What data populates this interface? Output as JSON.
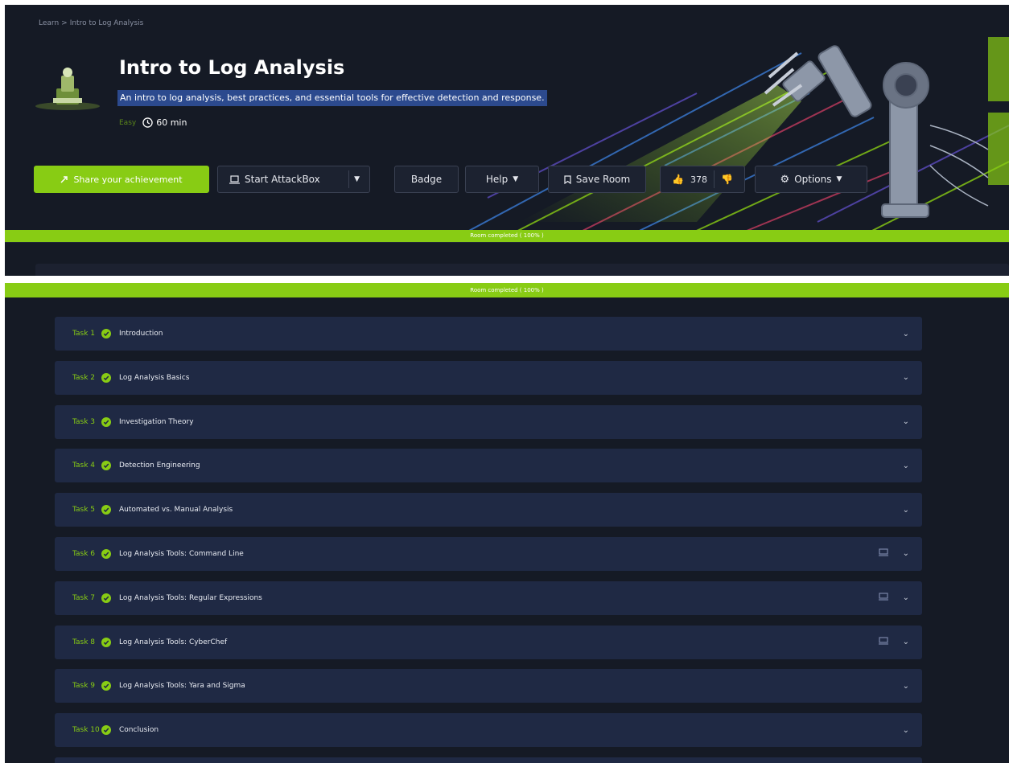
{
  "breadcrumb": {
    "root": "Learn",
    "separator": ">",
    "current": "Intro to Log Analysis"
  },
  "room": {
    "title": "Intro to Log Analysis",
    "description": "An intro to log analysis, best practices, and essential tools for effective detection and response.",
    "difficulty": "Easy",
    "duration": "60 min"
  },
  "toolbar": {
    "share_label": "Share your achievement",
    "attackbox_label": "Start AttackBox",
    "badge_label": "Badge",
    "help_label": "Help",
    "save_label": "Save Room",
    "likes": "378",
    "options_label": "Options"
  },
  "progress": {
    "label": "Room completed ( 100% )",
    "percent": 100
  },
  "tasks": [
    {
      "number": "Task 1",
      "title": "Introduction",
      "has_machine": false
    },
    {
      "number": "Task 2",
      "title": "Log Analysis Basics",
      "has_machine": false
    },
    {
      "number": "Task 3",
      "title": "Investigation Theory",
      "has_machine": false
    },
    {
      "number": "Task 4",
      "title": "Detection Engineering",
      "has_machine": false
    },
    {
      "number": "Task 5",
      "title": "Automated vs. Manual Analysis",
      "has_machine": false
    },
    {
      "number": "Task 6",
      "title": "Log Analysis Tools: Command Line",
      "has_machine": true
    },
    {
      "number": "Task 7",
      "title": "Log Analysis Tools: Regular Expressions",
      "has_machine": true
    },
    {
      "number": "Task 8",
      "title": "Log Analysis Tools: CyberChef",
      "has_machine": true
    },
    {
      "number": "Task 9",
      "title": "Log Analysis Tools: Yara and Sigma",
      "has_machine": false
    },
    {
      "number": "Task 10",
      "title": "Conclusion",
      "has_machine": false
    }
  ],
  "colors": {
    "accent": "#88cc14",
    "background": "#151a25",
    "task_card": "#1f2944",
    "highlight": "#2c4a8e"
  },
  "icons": {
    "clock": "clock-icon",
    "like": "thumbs-up-icon",
    "dislike": "thumbs-down-icon",
    "options": "gear-icon",
    "machine": "machine-icon",
    "expand": "chevron-down-icon",
    "check": "check-circle-icon"
  }
}
